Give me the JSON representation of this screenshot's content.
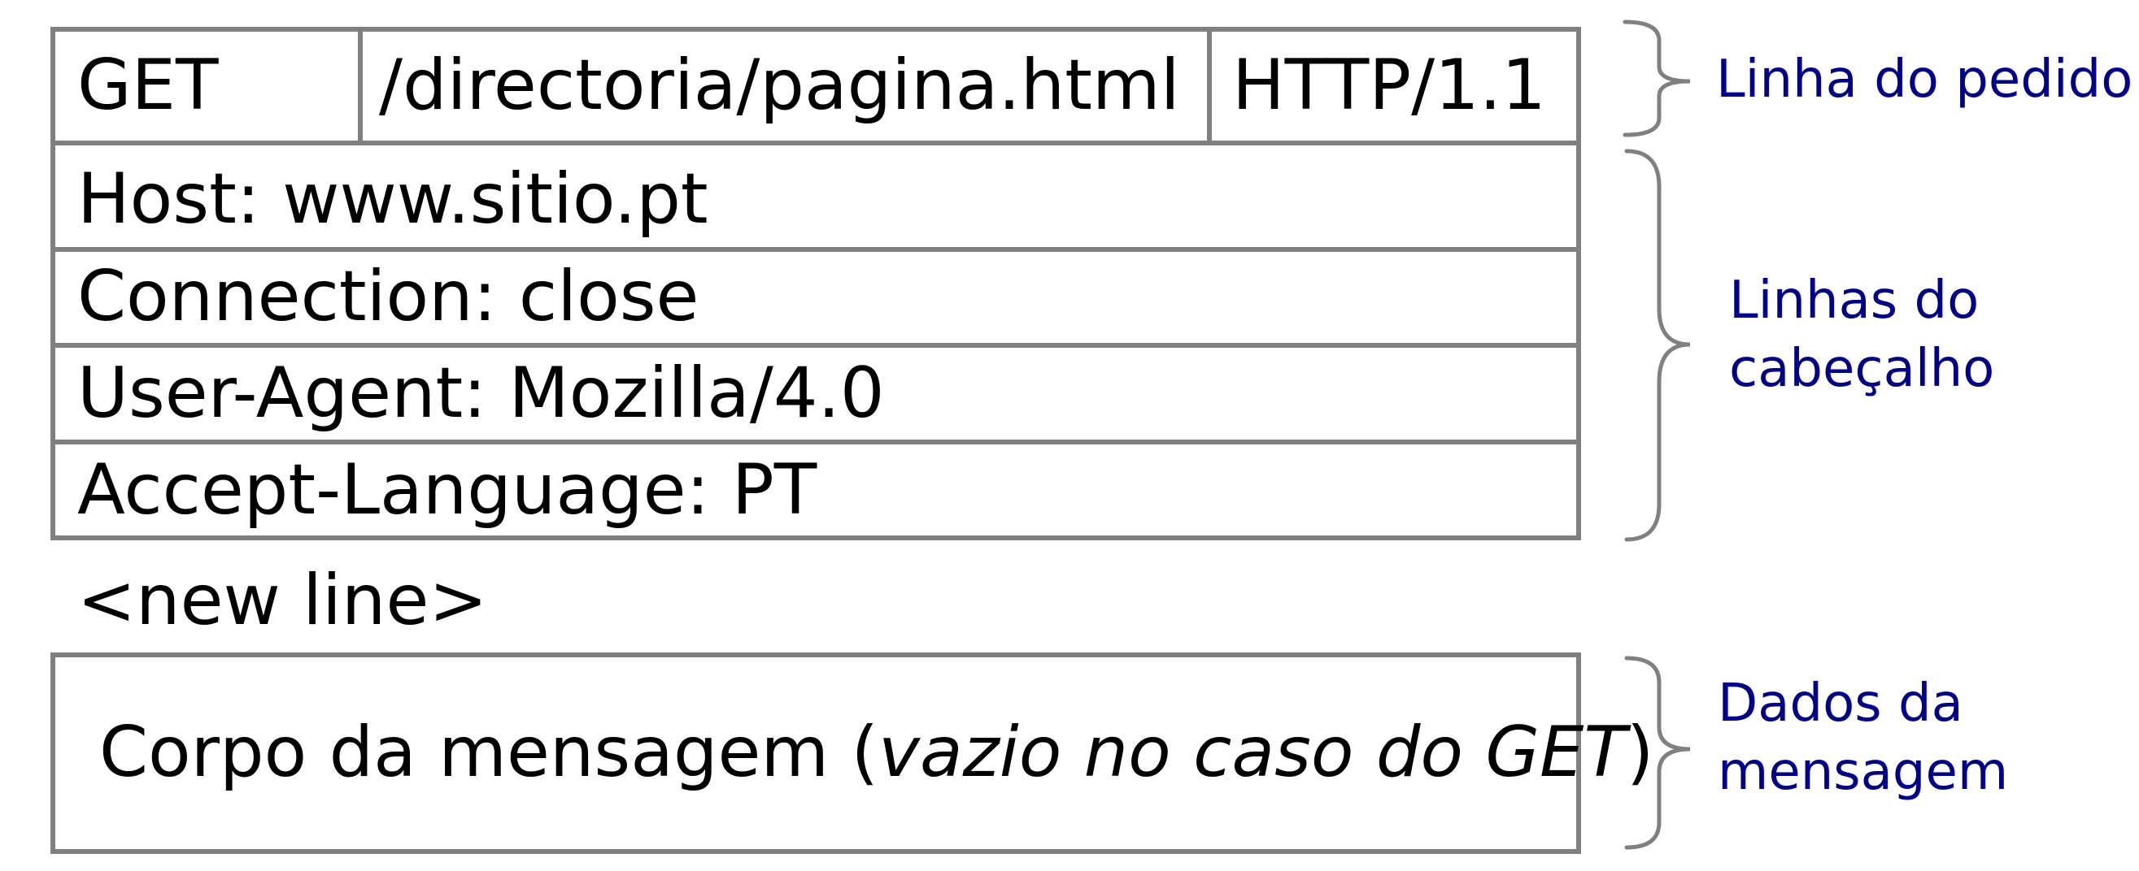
{
  "request_line": {
    "method": "GET",
    "path": "/directoria/pagina.html",
    "version": "HTTP/1.1"
  },
  "header_lines": [
    "Host: www.sitio.pt",
    "Connection: close",
    "User-Agent: Mozilla/4.0",
    "Accept-Language: PT"
  ],
  "separator": "<new line>",
  "message_body": {
    "text_start": "Corpo da mensagem (",
    "text_italic": "vazio no caso do GET",
    "text_end": ")"
  },
  "labels": {
    "request_line": "Linha do pedido",
    "header_lines": [
      "Linhas do",
      "cabeçalho"
    ],
    "message_data": [
      "Dados da",
      "mensagem"
    ]
  },
  "colors": {
    "border": "#808080",
    "label": "#00008b",
    "text": "#000000"
  }
}
